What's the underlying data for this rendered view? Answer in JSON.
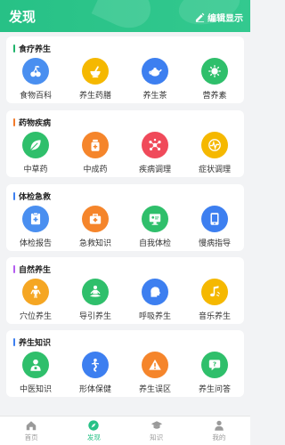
{
  "header": {
    "title": "发现",
    "edit_label": "编辑显示"
  },
  "sections": [
    {
      "title": "食疗养生",
      "bar_color": "#1fb36b",
      "items": [
        {
          "label": "食物百科",
          "icon": "cherry-icon",
          "color": "#4a8ff0"
        },
        {
          "label": "养生药膳",
          "icon": "mortar-icon",
          "color": "#f5b800"
        },
        {
          "label": "养生茶",
          "icon": "teapot-icon",
          "color": "#3d7ff0"
        },
        {
          "label": "营养素",
          "icon": "virus-icon",
          "color": "#2fbf6b"
        }
      ]
    },
    {
      "title": "药物疾病",
      "bar_color": "#f27a2b",
      "items": [
        {
          "label": "中草药",
          "icon": "herb-leaf-icon",
          "color": "#2fbf6b"
        },
        {
          "label": "中成药",
          "icon": "medicine-bottle-icon",
          "color": "#f5852b"
        },
        {
          "label": "疾病调理",
          "icon": "molecule-icon",
          "color": "#f04a5a"
        },
        {
          "label": "症状调理",
          "icon": "pulse-icon",
          "color": "#f5b800"
        }
      ]
    },
    {
      "title": "体检急救",
      "bar_color": "#3d7ff0",
      "items": [
        {
          "label": "体检报告",
          "icon": "report-icon",
          "color": "#4a8ff0"
        },
        {
          "label": "急救知识",
          "icon": "first-aid-kit-icon",
          "color": "#f5852b"
        },
        {
          "label": "自我体检",
          "icon": "monitor-icon",
          "color": "#2fbf6b"
        },
        {
          "label": "慢病指导",
          "icon": "tablet-icon",
          "color": "#3d7ff0"
        }
      ]
    },
    {
      "title": "自然养生",
      "bar_color": "#b45cf0",
      "items": [
        {
          "label": "穴位养生",
          "icon": "body-icon",
          "color": "#f5a623"
        },
        {
          "label": "导引养生",
          "icon": "meditation-icon",
          "color": "#2fbf6b"
        },
        {
          "label": "呼吸养生",
          "icon": "head-profile-icon",
          "color": "#3d7ff0"
        },
        {
          "label": "音乐养生",
          "icon": "music-note-icon",
          "color": "#f5b800"
        }
      ]
    },
    {
      "title": "养生知识",
      "bar_color": "#3d7ff0",
      "items": [
        {
          "label": "中医知识",
          "icon": "doctor-icon",
          "color": "#2fbf6b"
        },
        {
          "label": "形体保健",
          "icon": "figure-icon",
          "color": "#3d7ff0"
        },
        {
          "label": "养生误区",
          "icon": "warning-icon",
          "color": "#f5852b"
        },
        {
          "label": "养生问答",
          "icon": "qa-icon",
          "color": "#2fbf6b"
        }
      ]
    }
  ],
  "tabbar": [
    {
      "label": "首页",
      "icon": "home-icon",
      "active": false
    },
    {
      "label": "发现",
      "icon": "compass-icon",
      "active": true
    },
    {
      "label": "知识",
      "icon": "graduation-cap-icon",
      "active": false
    },
    {
      "label": "我的",
      "icon": "person-icon",
      "active": false
    }
  ],
  "colors": {
    "brand": "#27c186",
    "tab_inactive": "#9a9a9a"
  }
}
